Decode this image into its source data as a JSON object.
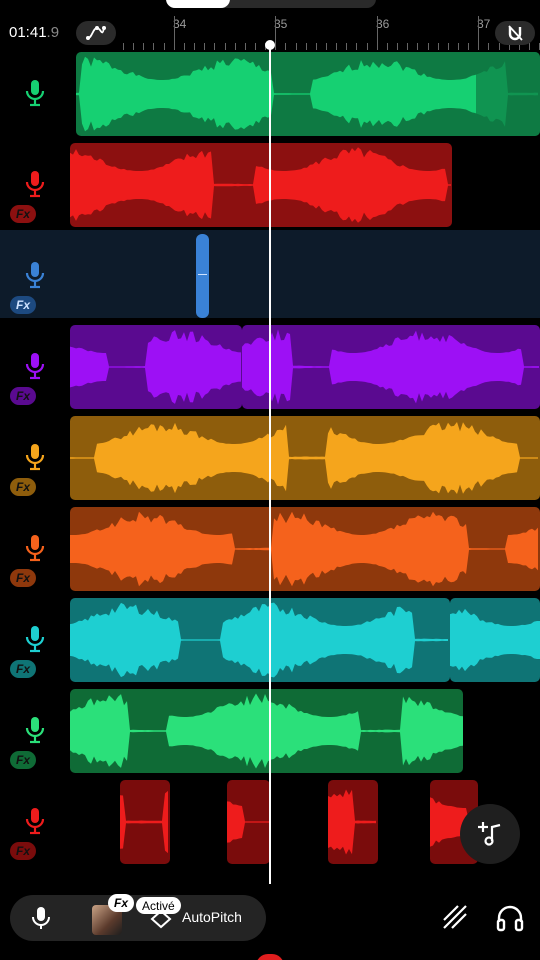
{
  "header": {
    "time_main": "01:41",
    "time_sub": ".9",
    "bar_labels": [
      "34",
      "35",
      "36",
      "37"
    ]
  },
  "tracks": [
    {
      "name": "track-1",
      "color": "#16d072",
      "dark": "#0e7a43",
      "fx": false,
      "clips": [
        [
          76,
          540,
          true
        ]
      ]
    },
    {
      "name": "track-2",
      "color": "#ee1c1c",
      "dark": "#8c1010",
      "fx": true,
      "clips": [
        [
          70,
          452,
          false
        ]
      ]
    },
    {
      "name": "track-3",
      "color": "#3a82d6",
      "dark": "#1d4a80",
      "fx": true,
      "selected": true,
      "clips": [
        [
          196,
          209,
          false
        ]
      ]
    },
    {
      "name": "track-4",
      "color": "#9d10f5",
      "dark": "#5a0a90",
      "fx": true,
      "clips": [
        [
          70,
          242,
          false
        ],
        [
          242,
          540,
          false
        ]
      ]
    },
    {
      "name": "track-5",
      "color": "#f5a51c",
      "dark": "#8e5d0c",
      "fx": true,
      "clips": [
        [
          70,
          540,
          false
        ]
      ]
    },
    {
      "name": "track-6",
      "color": "#f5621c",
      "dark": "#8e380c",
      "fx": true,
      "clips": [
        [
          70,
          540,
          false
        ]
      ]
    },
    {
      "name": "track-7",
      "color": "#1ecfd1",
      "dark": "#0f7475",
      "fx": true,
      "clips": [
        [
          70,
          450,
          false
        ],
        [
          450,
          540,
          false
        ]
      ]
    },
    {
      "name": "track-8",
      "color": "#2be07a",
      "dark": "#0f6b36",
      "fx": true,
      "clips": [
        [
          70,
          463,
          false
        ]
      ]
    },
    {
      "name": "track-9",
      "color": "#ee1c1c",
      "dark": "#7a0c0c",
      "fx": true,
      "clips": [
        [
          120,
          170,
          false
        ],
        [
          227,
          270,
          false
        ],
        [
          328,
          378,
          false
        ],
        [
          430,
          478,
          false
        ]
      ]
    }
  ],
  "bottom_bar": {
    "fx_label": "Fx",
    "active_label": "Activé",
    "autopitch_label": "AutoPitch"
  },
  "icons": {
    "automation": "automation-curve-icon",
    "snap": "magnet-off-icon",
    "mic": "microphone-icon",
    "add_track": "add-music-icon",
    "draw": "draw-lines-icon",
    "headphones": "headphones-icon"
  }
}
